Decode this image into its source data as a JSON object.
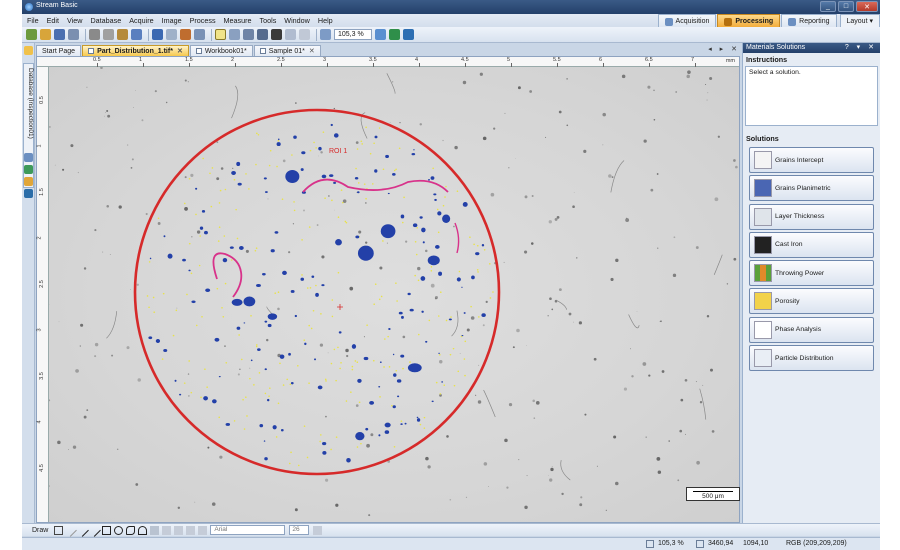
{
  "window": {
    "title": "Stream Basic",
    "controls": [
      "_",
      "□",
      "✕"
    ]
  },
  "menu": [
    "File",
    "Edit",
    "View",
    "Database",
    "Acquire",
    "Image",
    "Process",
    "Measure",
    "Tools",
    "Window",
    "Help"
  ],
  "modes": [
    {
      "label": "Acquisition",
      "active": false
    },
    {
      "label": "Processing",
      "active": true
    },
    {
      "label": "Reporting",
      "active": false
    }
  ],
  "layout_label": "Layout",
  "toolbar": {
    "zoom": "105,3 %"
  },
  "left_strip": {
    "vertical_tab": "Database (Inspection01)"
  },
  "doc_tabs": [
    {
      "label": "Start Page",
      "active": false,
      "closable": false
    },
    {
      "label": "Part_Distribution_1.tif*",
      "active": true,
      "closable": true
    },
    {
      "label": "Workbook01*",
      "active": false,
      "closable": false
    },
    {
      "label": "Sample 01*",
      "active": false,
      "closable": true
    }
  ],
  "doc_tab_controls": "◂ ▸ ✕",
  "ruler": {
    "unit": "mm",
    "top_labels": [
      "0.5",
      "1",
      "1.5",
      "2",
      "2.5",
      "3",
      "3.5",
      "4",
      "4.5",
      "5",
      "5.5",
      "6",
      "6.5",
      "7"
    ],
    "left_labels": [
      "0.5",
      "1",
      "1.5",
      "2",
      "2.5",
      "3",
      "3.5",
      "4",
      "4.5"
    ]
  },
  "image": {
    "roi_label": "ROI 1",
    "circle_color": "#d62a2a",
    "particle_color": "#2340a8",
    "fiber_color": "#d8328a",
    "scale_bar": "500 μm"
  },
  "right_panel": {
    "title": "Materials Solutions",
    "title_controls": "? ▾ ✕",
    "instructions_heading": "Instructions",
    "instructions_text": "Select a solution.",
    "solutions_heading": "Solutions",
    "solutions": [
      "Grains Intercept",
      "Grains Planimetric",
      "Layer Thickness",
      "Cast Iron",
      "Throwing Power",
      "Porosity",
      "Phase Analysis",
      "Particle Distribution"
    ]
  },
  "draw_toolbar": {
    "label": "Draw",
    "font": "Arial",
    "font_size": "26"
  },
  "status": {
    "zoom": "105,3 %",
    "x": "3460,94",
    "y": "1094,10",
    "color": "RGB (209,209,209)"
  }
}
